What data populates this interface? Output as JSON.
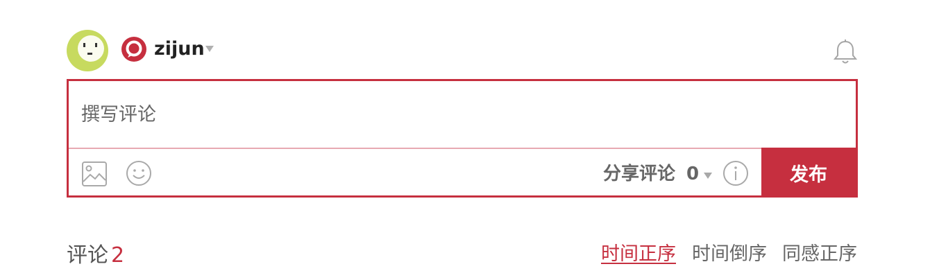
{
  "header": {
    "username": "zijun"
  },
  "composer": {
    "placeholder": "撰写评论",
    "share_label": "分享评论",
    "share_count": "0",
    "publish_label": "发布"
  },
  "comments": {
    "title": "评论",
    "count": "2",
    "sort_tabs": [
      {
        "label": "时间正序",
        "active": true
      },
      {
        "label": "时间倒序",
        "active": false
      },
      {
        "label": "同感正序",
        "active": false
      }
    ]
  },
  "colors": {
    "accent": "#c62f3f",
    "avatar": "#c7da5f",
    "divider": "#e7a9b2"
  },
  "icons": [
    "avatar-face",
    "service-logo",
    "chevron-down-icon",
    "bell-icon",
    "image-icon",
    "emoji-icon",
    "info-icon"
  ]
}
